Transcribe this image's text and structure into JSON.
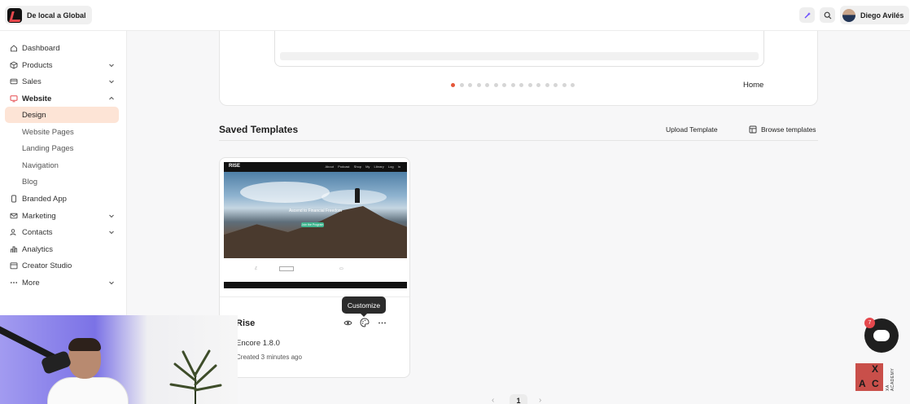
{
  "brand": {
    "name": "De local a Global"
  },
  "user": {
    "name": "Diego Avilés"
  },
  "sidebar": {
    "items": [
      {
        "label": "Dashboard",
        "icon": "home-icon"
      },
      {
        "label": "Products",
        "icon": "box-icon"
      },
      {
        "label": "Sales",
        "icon": "card-icon"
      },
      {
        "label": "Website",
        "icon": "monitor-icon"
      },
      {
        "label": "Design"
      },
      {
        "label": "Website Pages"
      },
      {
        "label": "Landing Pages"
      },
      {
        "label": "Navigation"
      },
      {
        "label": "Blog"
      },
      {
        "label": "Branded App",
        "icon": "phone-icon"
      },
      {
        "label": "Marketing",
        "icon": "mail-icon"
      },
      {
        "label": "Contacts",
        "icon": "users-icon"
      },
      {
        "label": "Analytics",
        "icon": "chart-icon"
      },
      {
        "label": "Creator Studio",
        "icon": "calendar-icon"
      },
      {
        "label": "More",
        "icon": "more-icon"
      }
    ]
  },
  "preview": {
    "page_name": "Home",
    "dot_count": 15,
    "active_dot": 0
  },
  "saved_templates": {
    "title": "Saved Templates",
    "upload_label": "Upload Template",
    "browse_label": "Browse templates",
    "card": {
      "name": "Rise",
      "version": "Encore 1.8.0",
      "created": "Created 3 minutes ago",
      "thumb_logo": "RISE",
      "thumb_headline": "Ascend to Financial Freedom",
      "thumb_cta": "Join the Program",
      "thumb_nav": "About Podcast Shop My Library Log In"
    },
    "tooltip": "Customize"
  },
  "pagination": {
    "current": "1"
  },
  "chat": {
    "badge": "7"
  },
  "academy": {
    "letters": [
      "X",
      "A",
      "C"
    ],
    "text": "XA ACADEMY"
  },
  "colors": {
    "accent": "#e5573a",
    "active_bg": "#fde4d6"
  }
}
